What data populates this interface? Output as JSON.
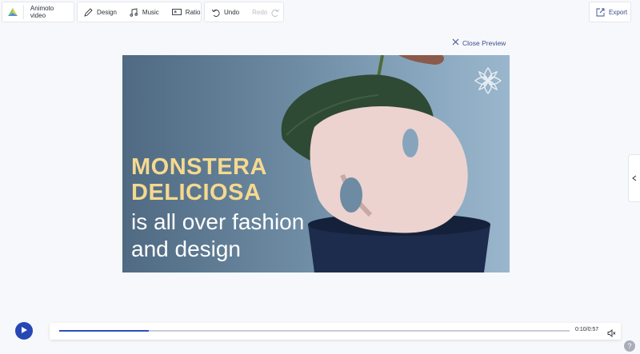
{
  "toolbar": {
    "project_title": "Animoto video",
    "design_label": "Design",
    "music_label": "Music",
    "ratio_label": "Ratio",
    "undo_label": "Undo",
    "redo_label": "Redo",
    "export_label": "Export"
  },
  "preview": {
    "close_label": "Close Preview"
  },
  "video": {
    "headline_line1": "MONSTERA",
    "headline_line2": "DELICIOSA",
    "sub_line1": "is all over fashion",
    "sub_line2": "and design",
    "headline_color": "#f5d98f",
    "sub_color": "#ffffff"
  },
  "player": {
    "time": "0:10/0:57",
    "progress_fraction": 0.175,
    "accent": "#2747b5"
  },
  "help": {
    "label": "?"
  }
}
